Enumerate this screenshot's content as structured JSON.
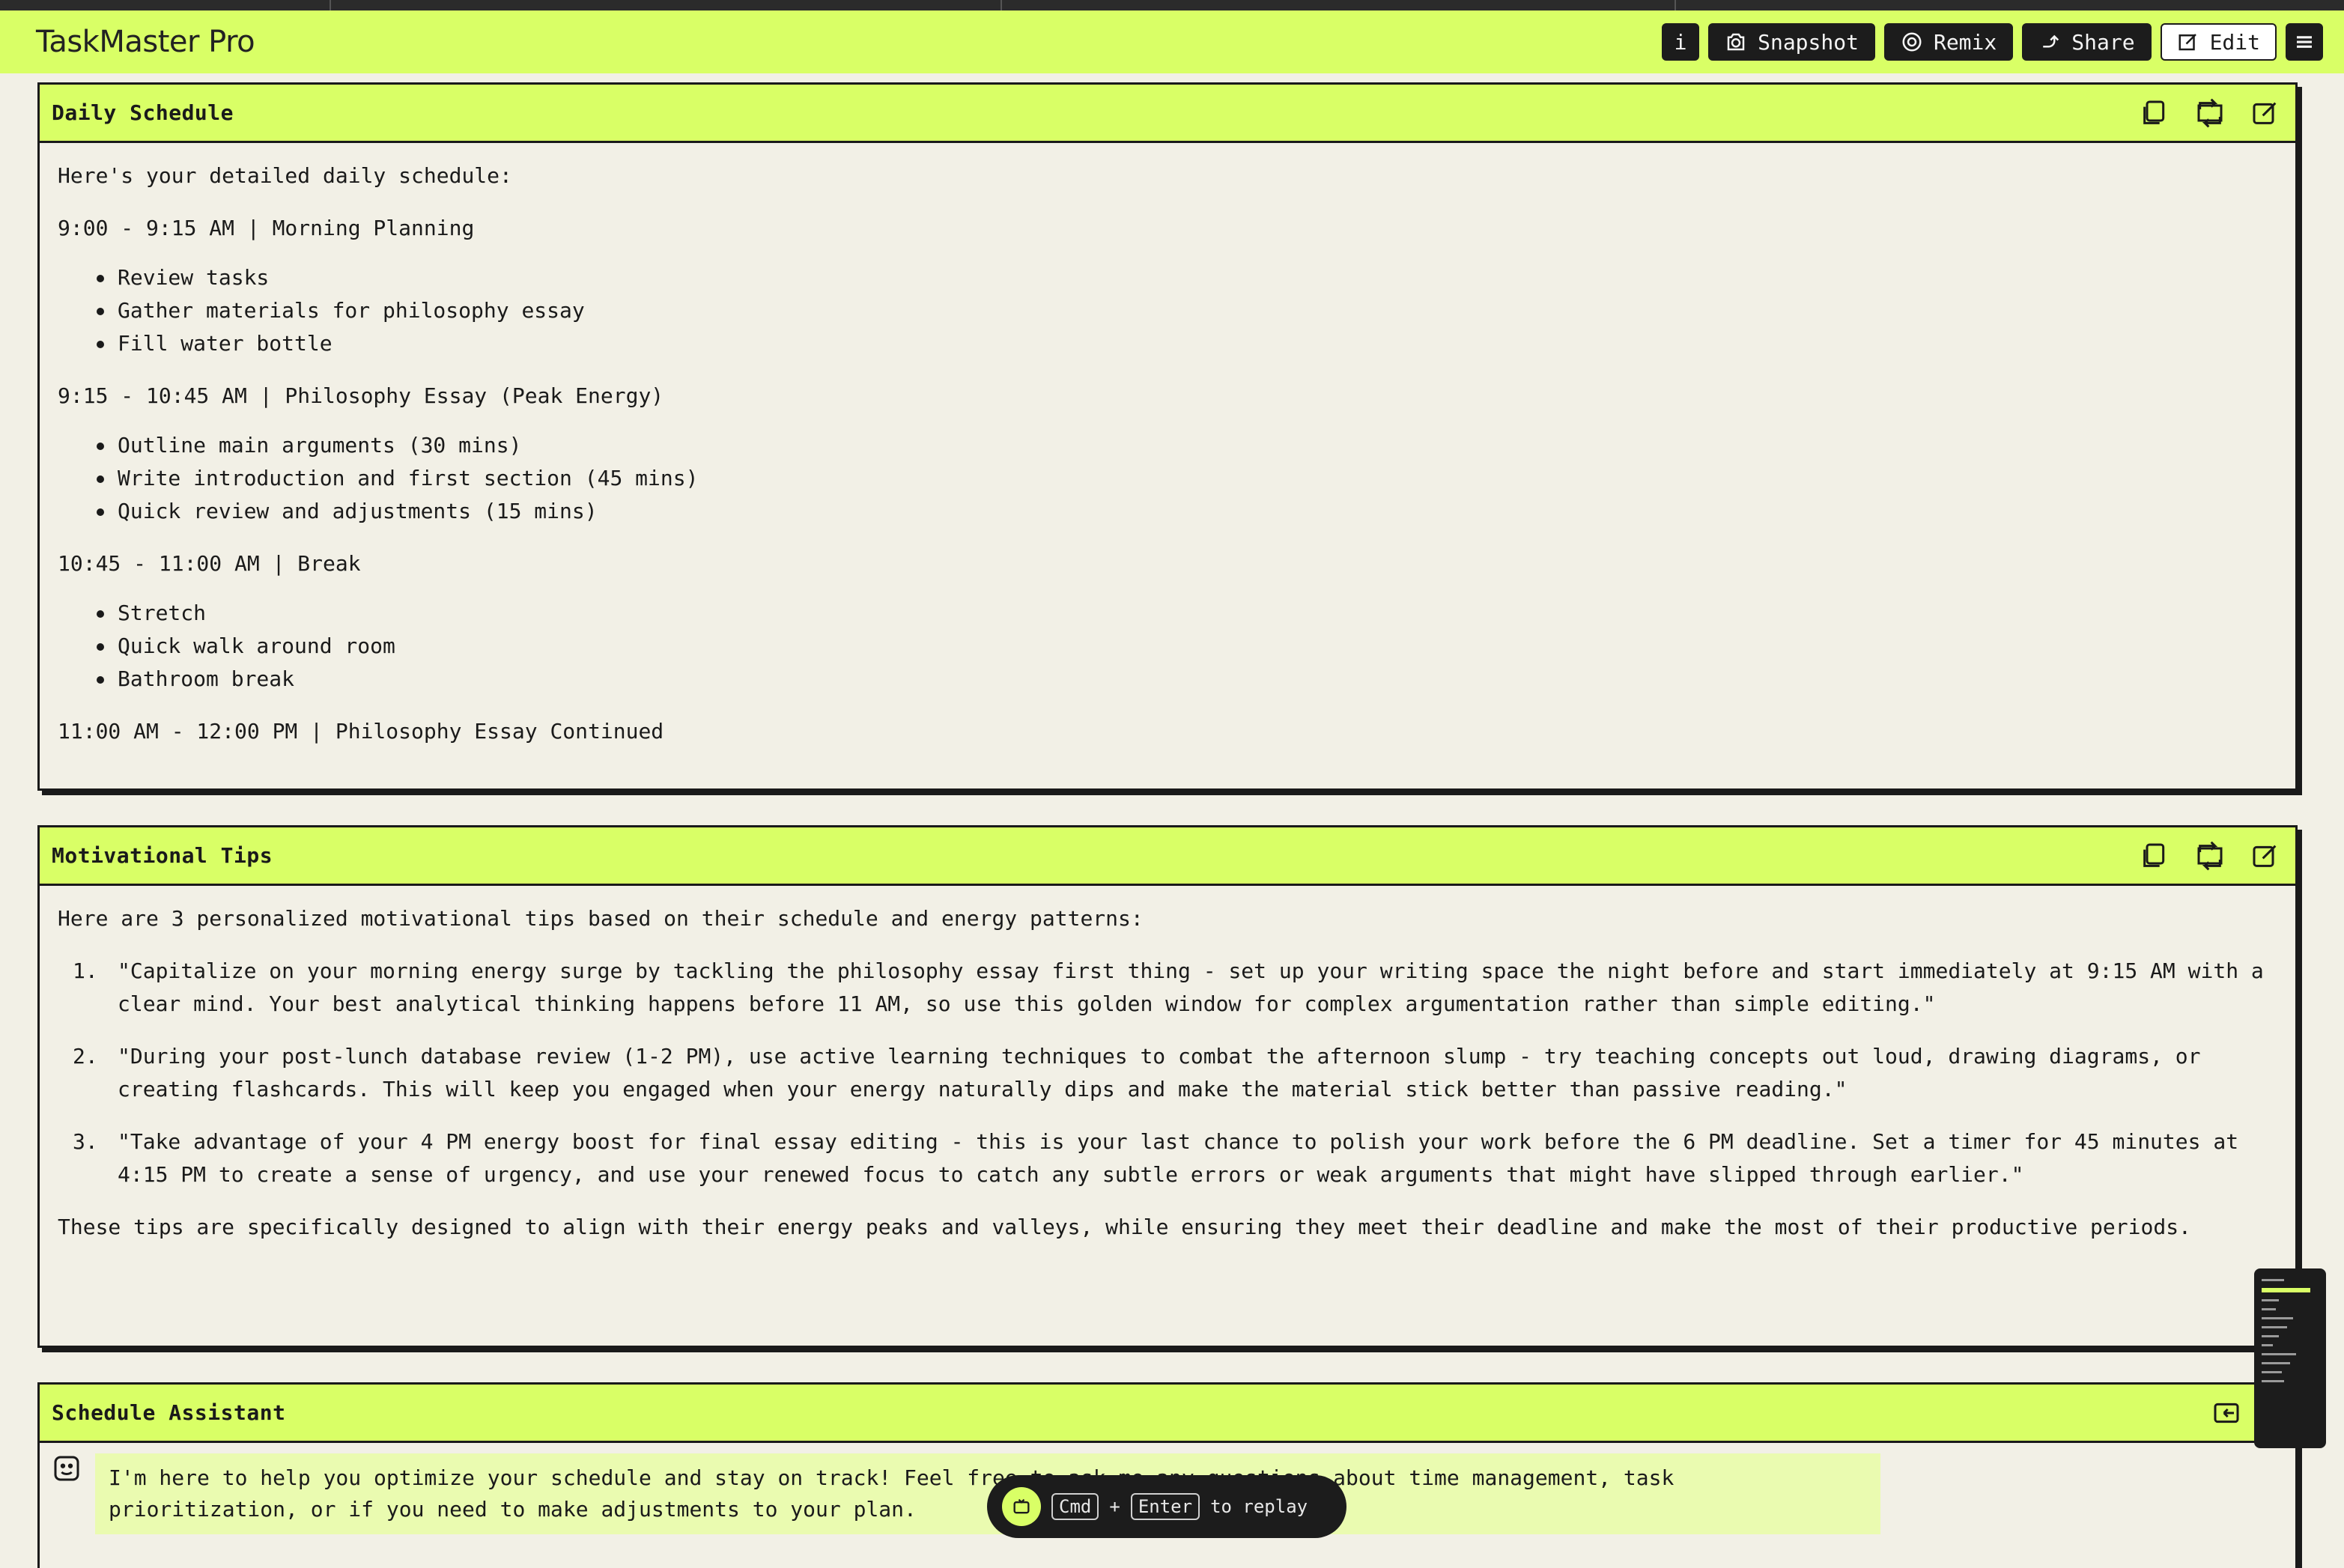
{
  "app": {
    "title": "TaskMaster Pro"
  },
  "toolbar": {
    "info_label": "i",
    "snapshot_label": "Snapshot",
    "remix_label": "Remix",
    "share_label": "Share",
    "edit_label": "Edit"
  },
  "daily_schedule": {
    "title": "Daily Schedule",
    "intro": "Here's your detailed daily schedule:",
    "blocks": [
      {
        "heading": "9:00 - 9:15 AM | Morning Planning",
        "items": [
          "Review tasks",
          "Gather materials for philosophy essay",
          "Fill water bottle"
        ]
      },
      {
        "heading": "9:15 - 10:45 AM | Philosophy Essay (Peak Energy)",
        "items": [
          "Outline main arguments (30 mins)",
          "Write introduction and first section (45 mins)",
          "Quick review and adjustments (15 mins)"
        ]
      },
      {
        "heading": "10:45 - 11:00 AM | Break",
        "items": [
          "Stretch",
          "Quick walk around room",
          "Bathroom break"
        ]
      },
      {
        "heading": "11:00 AM - 12:00 PM | Philosophy Essay Continued",
        "items": []
      }
    ]
  },
  "motivational_tips": {
    "title": "Motivational Tips",
    "intro": "Here are 3 personalized motivational tips based on their schedule and energy patterns:",
    "tips": [
      {
        "num": "1.",
        "text": "\"Capitalize on your morning energy surge by tackling the philosophy essay first thing - set up your writing space the night before and start immediately at 9:15 AM with a clear mind. Your best analytical thinking happens before 11 AM, so use this golden window for complex argumentation rather than simple editing.\""
      },
      {
        "num": "2.",
        "text": "\"During your post-lunch database review (1-2 PM), use active learning techniques to combat the afternoon slump - try teaching concepts out loud, drawing diagrams, or creating flashcards. This will keep you engaged when your energy naturally dips and make the material stick better than passive reading.\""
      },
      {
        "num": "3.",
        "text": "\"Take advantage of your 4 PM energy boost for final essay editing - this is your last chance to polish your work before the 6 PM deadline. Set a timer for 45 minutes at 4:15 PM to create a sense of urgency, and use your renewed focus to catch any subtle errors or weak arguments that might have slipped through earlier.\""
      }
    ],
    "outro": "These tips are specifically designed to align with their energy peaks and valleys, while ensuring they meet their deadline and make the most of their productive periods."
  },
  "schedule_assistant": {
    "title": "Schedule Assistant",
    "message": "I'm here to help you optimize your schedule and stay on track! Feel free to ask me any questions about time management, task prioritization, or if you need to make adjustments to your plan."
  },
  "replay": {
    "key1": "Cmd",
    "plus": "+",
    "key2": "Enter",
    "suffix": "to replay"
  },
  "icons": {
    "panel_actions": [
      "copy-icon",
      "refresh-icon",
      "edit-icon"
    ],
    "assistant_action": "collapse-icon",
    "avatar": "bot-face-icon"
  },
  "colors": {
    "accent": "#d9ff66",
    "dark": "#1c1c1c",
    "background": "#f2f0e6",
    "bubble": "#eafbb0"
  }
}
